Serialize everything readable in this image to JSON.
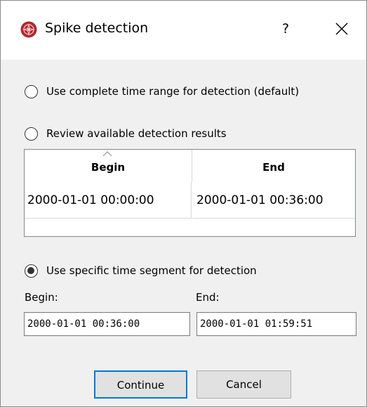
{
  "window": {
    "title": "Spike detection",
    "help_label": "?",
    "app_icon": "spike-app-icon",
    "close_icon": "close-icon"
  },
  "options": {
    "complete_range_label": "Use complete time range for detection (default)",
    "complete_range_checked": false,
    "review_results_label": "Review available detection results",
    "review_results_checked": false,
    "specific_segment_label": "Use specific time segment for detection",
    "specific_segment_checked": true
  },
  "results_table": {
    "columns": [
      "Begin",
      "End"
    ],
    "rows": [
      {
        "begin": "2000-01-01 00:00:00",
        "end": "2000-01-01 00:36:00"
      }
    ],
    "sort_icon": "sort-ascending-icon"
  },
  "segment": {
    "begin_label": "Begin:",
    "end_label": "End:",
    "begin_value": "2000-01-01 00:36:00",
    "end_value": "2000-01-01 01:59:51"
  },
  "buttons": {
    "continue_label": "Continue",
    "cancel_label": "Cancel"
  },
  "colors": {
    "focus_border": "#0078d7",
    "app_icon": "#b0282f",
    "dialog_background": "#f0f0f0"
  }
}
